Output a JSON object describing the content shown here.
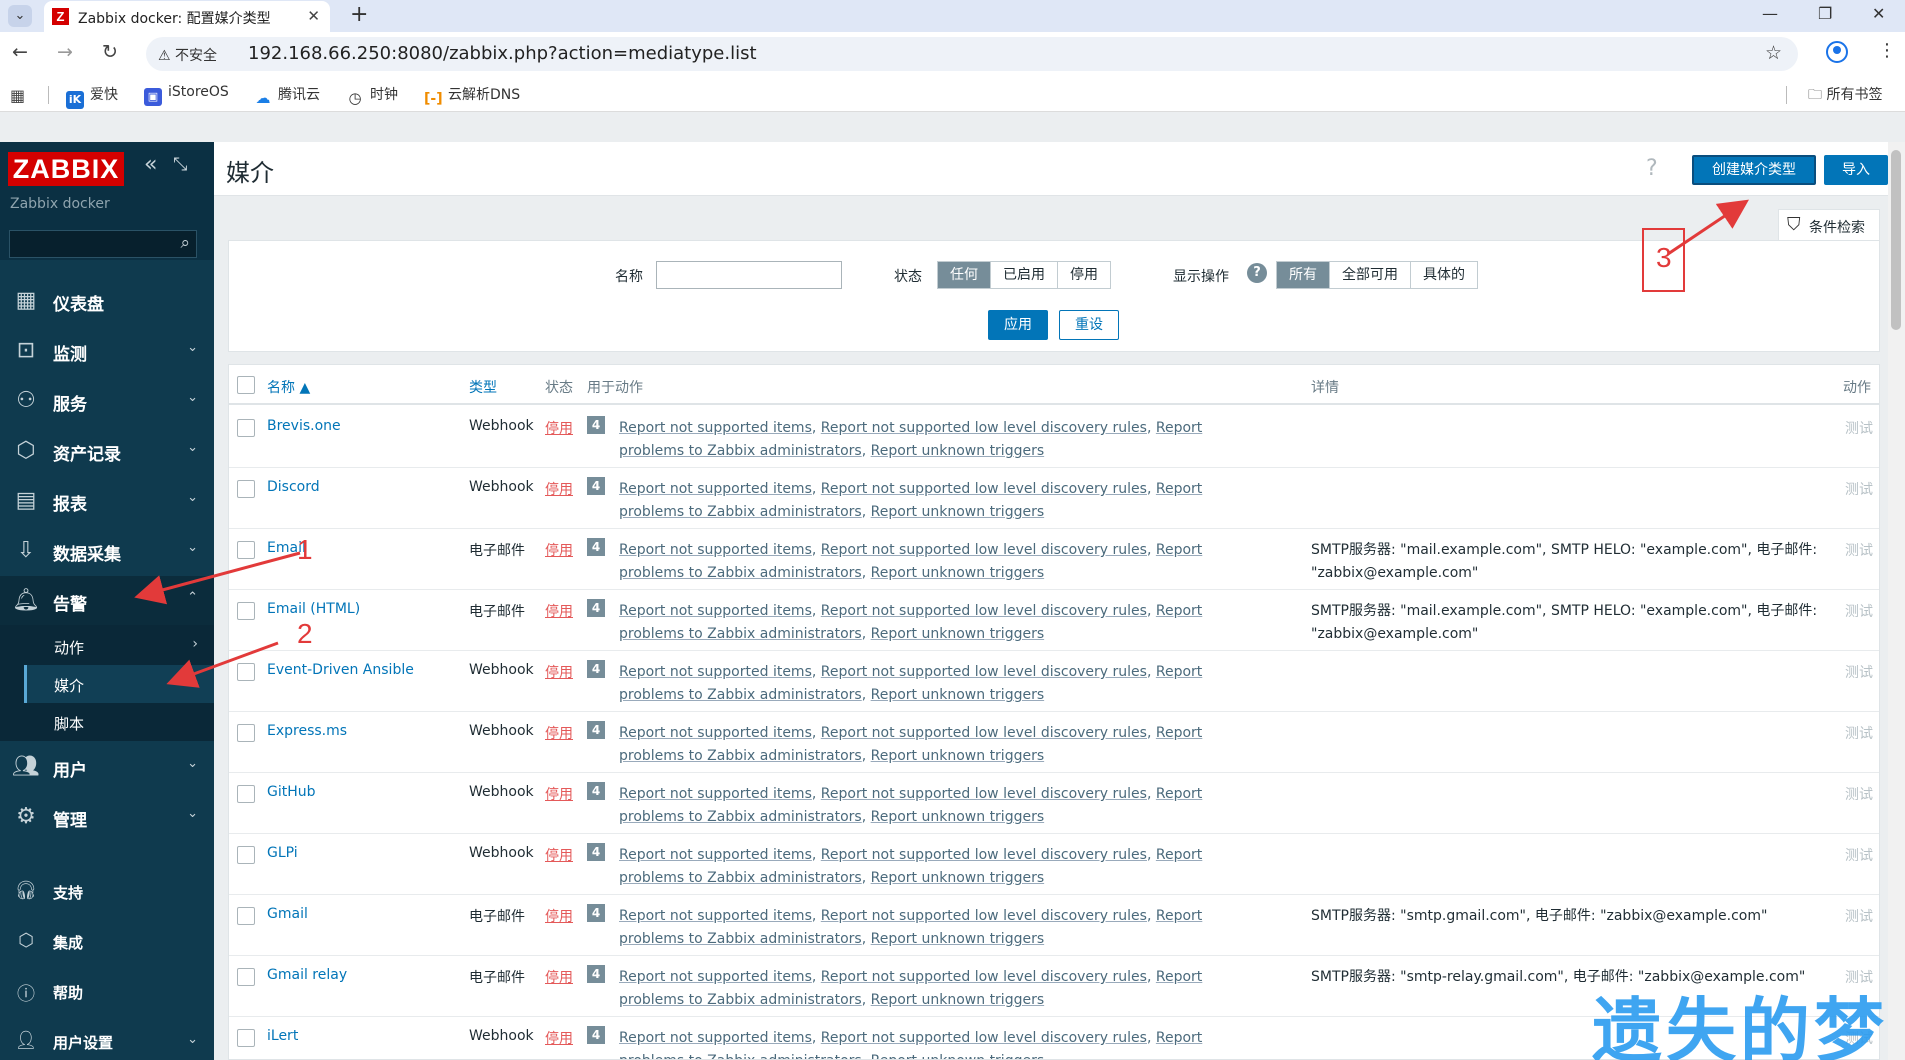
{
  "browser": {
    "tab_title": "Zabbix docker: 配置媒介类型",
    "tab_favicon": "Z",
    "url_warning": "不安全",
    "url": "192.168.66.250:8080/zabbix.php?action=mediatype.list",
    "bookmarks": [
      "爱快",
      "iStoreOS",
      "腾讯云",
      "时钟",
      "云解析DNS"
    ],
    "bookmarks_all": "所有书签"
  },
  "sidebar": {
    "logo": "ZABBIX",
    "server_name": "Zabbix docker",
    "items": [
      {
        "label": "仪表盘",
        "icon": "dashboard-icon"
      },
      {
        "label": "监测",
        "icon": "monitoring-icon"
      },
      {
        "label": "服务",
        "icon": "services-icon"
      },
      {
        "label": "资产记录",
        "icon": "inventory-icon"
      },
      {
        "label": "报表",
        "icon": "reports-icon"
      },
      {
        "label": "数据采集",
        "icon": "data-collection-icon"
      },
      {
        "label": "告警",
        "icon": "bell-icon"
      }
    ],
    "alerts_sub": [
      {
        "label": "动作"
      },
      {
        "label": "媒介"
      },
      {
        "label": "脚本"
      }
    ],
    "items2": [
      {
        "label": "用户",
        "icon": "users-icon"
      },
      {
        "label": "管理",
        "icon": "gear-icon"
      }
    ],
    "bottom": [
      {
        "label": "支持",
        "icon": "headset-icon"
      },
      {
        "label": "集成",
        "icon": "integrations-icon"
      },
      {
        "label": "帮助",
        "icon": "help-icon"
      },
      {
        "label": "用户设置",
        "icon": "user-settings-icon"
      }
    ]
  },
  "header": {
    "title": "媒介",
    "create_label": "创建媒介类型",
    "import_label": "导入",
    "help": "?"
  },
  "filter": {
    "tab_label": "条件检索",
    "name_label": "名称",
    "name_value": "",
    "status_label": "状态",
    "status_options": [
      "任何",
      "已启用",
      "停用"
    ],
    "show_label": "显示操作",
    "show_options": [
      "所有",
      "全部可用",
      "具体的"
    ],
    "apply_label": "应用",
    "reset_label": "重设"
  },
  "table": {
    "columns": {
      "name": "名称 ▲",
      "type": "类型",
      "status": "状态",
      "used": "用于动作",
      "details": "详情",
      "action": "动作"
    },
    "action_links": [
      "Report not supported items",
      "Report not supported low level discovery rules",
      "Report problems to Zabbix administrators",
      "Report unknown triggers"
    ],
    "rows": [
      {
        "name": "Brevis.one",
        "type": "Webhook",
        "status": "停用",
        "count": "4",
        "details": "",
        "test": "测试"
      },
      {
        "name": "Discord",
        "type": "Webhook",
        "status": "停用",
        "count": "4",
        "details": "",
        "test": "测试"
      },
      {
        "name": "Email",
        "type": "电子邮件",
        "status": "停用",
        "count": "4",
        "details": "SMTP服务器: \"mail.example.com\", SMTP HELO: \"example.com\", 电子邮件: \"zabbix@example.com\"",
        "test": "测试"
      },
      {
        "name": "Email (HTML)",
        "type": "电子邮件",
        "status": "停用",
        "count": "4",
        "details": "SMTP服务器: \"mail.example.com\", SMTP HELO: \"example.com\", 电子邮件: \"zabbix@example.com\"",
        "test": "测试"
      },
      {
        "name": "Event-Driven Ansible",
        "type": "Webhook",
        "status": "停用",
        "count": "4",
        "details": "",
        "test": "测试"
      },
      {
        "name": "Express.ms",
        "type": "Webhook",
        "status": "停用",
        "count": "4",
        "details": "",
        "test": "测试"
      },
      {
        "name": "GitHub",
        "type": "Webhook",
        "status": "停用",
        "count": "4",
        "details": "",
        "test": "测试"
      },
      {
        "name": "GLPi",
        "type": "Webhook",
        "status": "停用",
        "count": "4",
        "details": "",
        "test": "测试"
      },
      {
        "name": "Gmail",
        "type": "电子邮件",
        "status": "停用",
        "count": "4",
        "details": "SMTP服务器: \"smtp.gmail.com\", 电子邮件: \"zabbix@example.com\"",
        "test": "测试"
      },
      {
        "name": "Gmail relay",
        "type": "电子邮件",
        "status": "停用",
        "count": "4",
        "details": "SMTP服务器: \"smtp-relay.gmail.com\", 电子邮件: \"zabbix@example.com\"",
        "test": "测试"
      },
      {
        "name": "iLert",
        "type": "Webhook",
        "status": "停用",
        "count": "4",
        "details": "",
        "test": "测试"
      }
    ]
  },
  "annotations": [
    "1",
    "2",
    "3"
  ],
  "watermark": "遗失的梦",
  "colors": {
    "accent": "#0275b8",
    "sidebar": "#0f3a4e",
    "disabled": "#e45959",
    "annotation": "#e23a3a",
    "logo": "#d40000"
  }
}
